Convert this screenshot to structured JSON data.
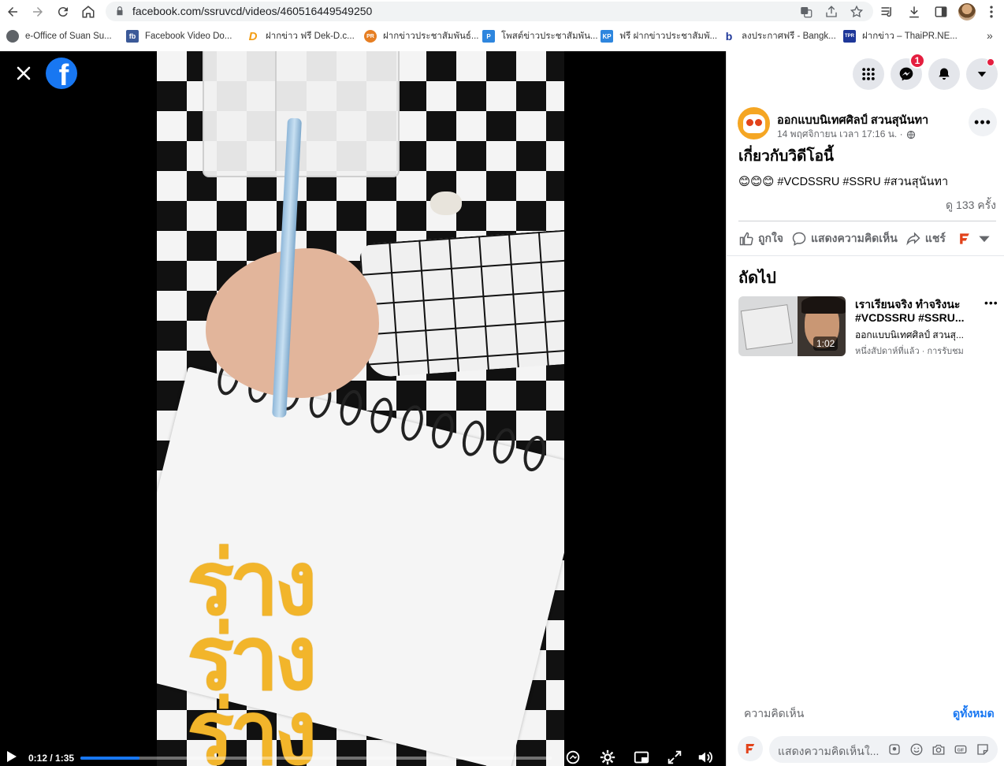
{
  "browser": {
    "url": "facebook.com/ssruvcd/videos/460516449549250",
    "bookmarks": [
      {
        "label": "e-Office of Suan Su...",
        "icon": "globe-icon",
        "color": "#5f6368"
      },
      {
        "label": "Facebook Video Do...",
        "icon": "fb-text-icon",
        "color": "#3b5998"
      },
      {
        "label": "ฝากข่าว ฟรี Dek-D.c...",
        "icon": "dekd-icon",
        "color": "#f39c12"
      },
      {
        "label": "ฝากข่าวประชาสัมพันธ์...",
        "icon": "pr-icon",
        "color": "#e67e22"
      },
      {
        "label": "โพสต์ข่าวประชาสัมพัน...",
        "icon": "post-icon",
        "color": "#2e86de"
      },
      {
        "label": "ฟรี ฝากข่าวประชาสัมพั...",
        "icon": "kp-icon",
        "color": "#2e86de"
      },
      {
        "label": "ลงประกาศฟรี - Bangk...",
        "icon": "b-icon",
        "color": "#1e3799"
      },
      {
        "label": "ฝากข่าว – ThaiPR.NE...",
        "icon": "thaipr-icon",
        "color": "#1e3799"
      }
    ],
    "bookmarks_more": "»"
  },
  "video": {
    "overlay_lines": [
      "ร่าง",
      "ร่าง",
      "ร่าง"
    ],
    "current_time": "0:12",
    "duration": "1:35",
    "time_display": "0:12 / 1:35",
    "progress_fraction": 0.126
  },
  "header": {
    "notification_count": "1"
  },
  "post": {
    "page_name": "ออกแบบนิเทศศิลป์ สวนสุนันทา",
    "date": "14 พฤศจิกายน เวลา 17:16 น. ·",
    "about_title": "เกี่ยวกับวิดีโอนี้",
    "text": "😊😊😊 #VCDSSRU #SSRU #สวนสุนันทา",
    "views": "ดู 133 ครั้ง",
    "actions": {
      "like": "ถูกใจ",
      "comment": "แสดงความคิดเห็น",
      "share": "แชร์"
    }
  },
  "up_next": {
    "title": "ถัดไป",
    "items": [
      {
        "line1": "เราเรียนจริง ทำจริงนะ",
        "line2": "#VCDSSRU #SSRU...",
        "channel": "ออกแบบนิเทศศิลป์ สวนสุ...",
        "meta": "หนึ่งสัปดาห์ที่แล้ว · การรับชม",
        "duration": "1:02"
      }
    ]
  },
  "comments": {
    "label": "ความคิดเห็น",
    "see_all": "ดูทั้งหมด",
    "placeholder": "แสดงความคิดเห็นใ..."
  },
  "colors": {
    "fb_blue": "#1877f2",
    "accent_yellow": "#f2b52b",
    "badge_red": "#e41e3f"
  }
}
